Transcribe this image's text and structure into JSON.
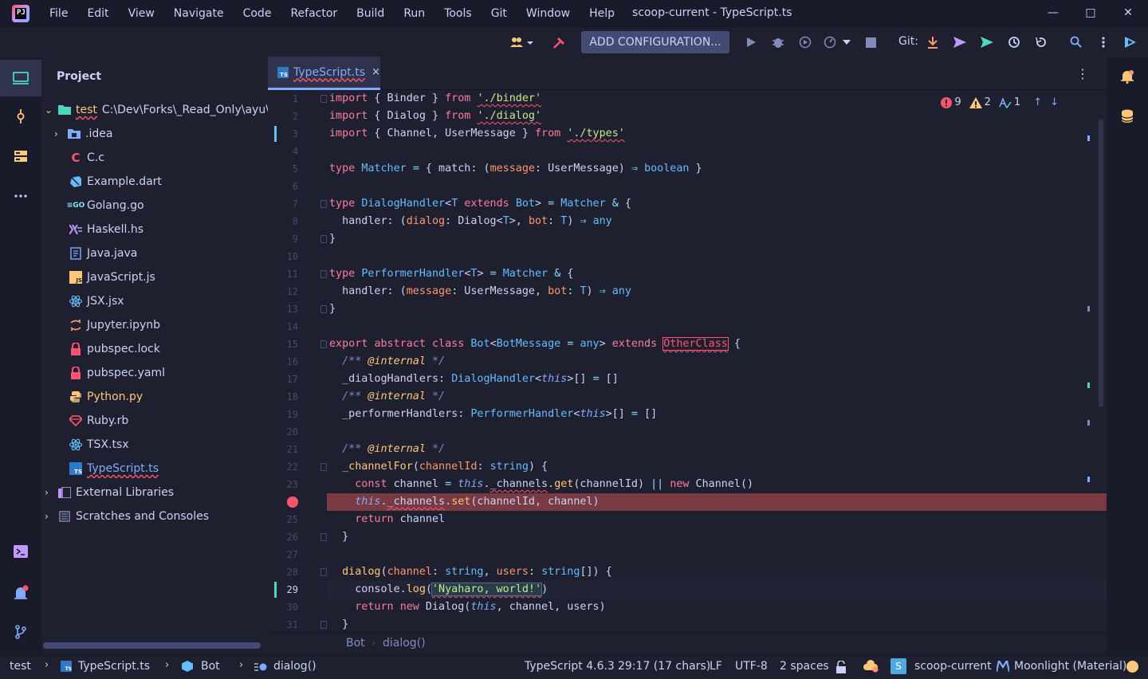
{
  "app": {
    "window_title": "scoop-current - TypeScript.ts",
    "menu": [
      "File",
      "Edit",
      "View",
      "Navigate",
      "Code",
      "Refactor",
      "Build",
      "Run",
      "Tools",
      "Git",
      "Window",
      "Help"
    ]
  },
  "toolbar": {
    "add_configuration": "ADD CONFIGURATION...",
    "git_label": "Git:"
  },
  "project": {
    "title": "Project",
    "root_name": "test",
    "root_path": "C:\\Dev\\Forks\\_Read_Only\\ayu\\test",
    "items": [
      {
        "label": ".idea",
        "icon": "folder-idea-icon",
        "folder": true
      },
      {
        "label": "C.c",
        "icon": "c-file-icon"
      },
      {
        "label": "Example.dart",
        "icon": "dart-file-icon"
      },
      {
        "label": "Golang.go",
        "icon": "go-file-icon"
      },
      {
        "label": "Haskell.hs",
        "icon": "haskell-file-icon"
      },
      {
        "label": "Java.java",
        "icon": "java-file-icon"
      },
      {
        "label": "JavaScript.js",
        "icon": "javascript-file-icon"
      },
      {
        "label": "JSX.jsx",
        "icon": "react-file-icon"
      },
      {
        "label": "Jupyter.ipynb",
        "icon": "jupyter-file-icon"
      },
      {
        "label": "pubspec.lock",
        "icon": "lock-file-icon"
      },
      {
        "label": "pubspec.yaml",
        "icon": "lock-file-icon"
      },
      {
        "label": "Python.py",
        "icon": "python-file-icon"
      },
      {
        "label": "Ruby.rb",
        "icon": "ruby-file-icon"
      },
      {
        "label": "TSX.tsx",
        "icon": "react-file-icon"
      },
      {
        "label": "TypeScript.ts",
        "icon": "typescript-file-icon"
      }
    ],
    "external_libraries": "External Libraries",
    "scratches": "Scratches and Consoles"
  },
  "editor": {
    "tab_label": "TypeScript.ts",
    "tab_close": "×",
    "inspections": {
      "errors": "9",
      "warnings": "2",
      "typos": "1"
    },
    "current_line": 29,
    "breakpoint_line": 24,
    "line_numbers": [
      "1",
      "2",
      "3",
      "4",
      "5",
      "6",
      "7",
      "8",
      "9",
      "10",
      "11",
      "12",
      "13",
      "14",
      "15",
      "16",
      "17",
      "18",
      "19",
      "20",
      "21",
      "22",
      "23",
      "24",
      "25",
      "26",
      "27",
      "28",
      "29",
      "30",
      "31"
    ],
    "breadcrumb": {
      "class": "Bot",
      "separator": "›",
      "method": "dialog()"
    }
  },
  "statusbar": {
    "project": "test",
    "file": "TypeScript.ts",
    "class": "Bot",
    "method": "dialog()",
    "language": "TypeScript 4.6.3",
    "position": "29:17 (17 chars)",
    "line_sep": "LF",
    "encoding": "UTF-8",
    "indent": "2 spaces",
    "scoop": "scoop-current",
    "theme": "Moonlight (Material)"
  },
  "colors": {
    "accent": "#82aaff",
    "breakpoint": "#ff5370",
    "keyword": "#fc7b9e",
    "string": "#c3e88d",
    "type": "#65bcff"
  }
}
